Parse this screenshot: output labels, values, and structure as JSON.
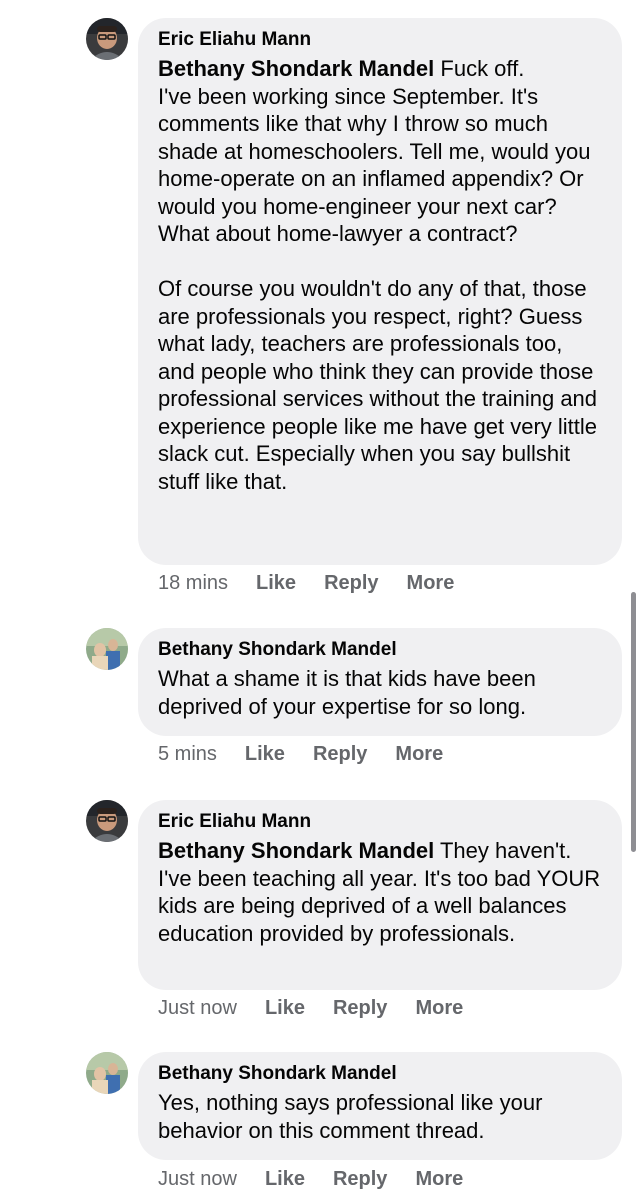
{
  "comments": [
    {
      "author": "Eric Eliahu Mann",
      "mention": "Bethany Shondark Mandel",
      "text": " Fuck off.\nI've been working since September. It's comments like that why I throw so much shade at homeschoolers. Tell me, would you home-operate on an inflamed appendix? Or would you home-engineer your next car? What about home-lawyer a contract?\n\nOf course you wouldn't do any of that, those are professionals you respect, right? Guess what lady, teachers are professionals too, and people who think they can provide those professional services without the training and experience people like me have get very little slack cut. Especially when you say bullshit stuff like that.",
      "time": "18 mins",
      "like": "Like",
      "reply": "Reply",
      "more": "More"
    },
    {
      "author": "Bethany Shondark Mandel",
      "mention": "",
      "text": "What a shame it is that kids have been deprived of your expertise for so long.",
      "time": "5 mins",
      "like": "Like",
      "reply": "Reply",
      "more": "More"
    },
    {
      "author": "Eric Eliahu Mann",
      "mention": "Bethany Shondark Mandel",
      "text": " They haven't. I've been teaching all year. It's too bad YOUR kids are being deprived of a well balances education provided by professionals.",
      "time": "Just now",
      "like": "Like",
      "reply": "Reply",
      "more": "More"
    },
    {
      "author": "Bethany Shondark Mandel",
      "mention": "",
      "text": "Yes, nothing says professional like your behavior on this comment thread.",
      "time": "Just now",
      "like": "Like",
      "reply": "Reply",
      "more": "More"
    }
  ],
  "colors": {
    "bubble": "#f0f0f2",
    "meta": "#65676b",
    "text": "#050505"
  }
}
